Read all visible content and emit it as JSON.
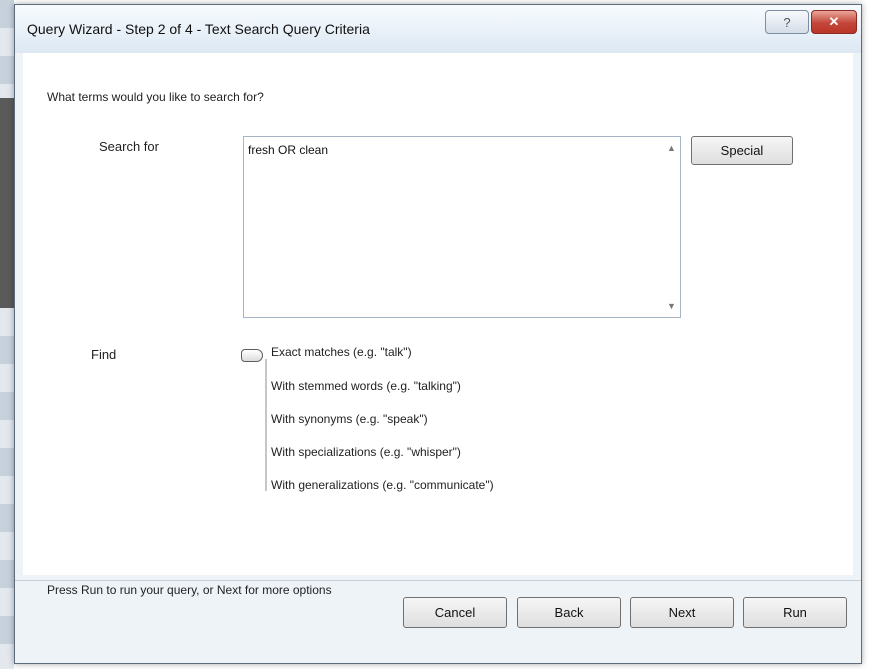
{
  "window": {
    "title": "Query Wizard - Step 2 of 4 - Text Search Query Criteria",
    "help_label": "?",
    "close_label": "✕"
  },
  "prompt": "What terms would you like to search for?",
  "search": {
    "label": "Search for",
    "value": "fresh OR clean",
    "scroll_up": "▲",
    "scroll_down": "▼",
    "special_label": "Special"
  },
  "find": {
    "label": "Find",
    "options": [
      "Exact matches (e.g. \"talk\")",
      "With stemmed words (e.g. \"talking\")",
      "With synonyms (e.g. \"speak\")",
      "With specializations (e.g. \"whisper\")",
      "With generalizations (e.g. \"communicate\")"
    ],
    "selected": "Exact matches (e.g. \"talk\")"
  },
  "status_text": "Press Run to run your query, or Next for more options",
  "buttons": {
    "cancel": "Cancel",
    "back": "Back",
    "next": "Next",
    "run": "Run"
  }
}
